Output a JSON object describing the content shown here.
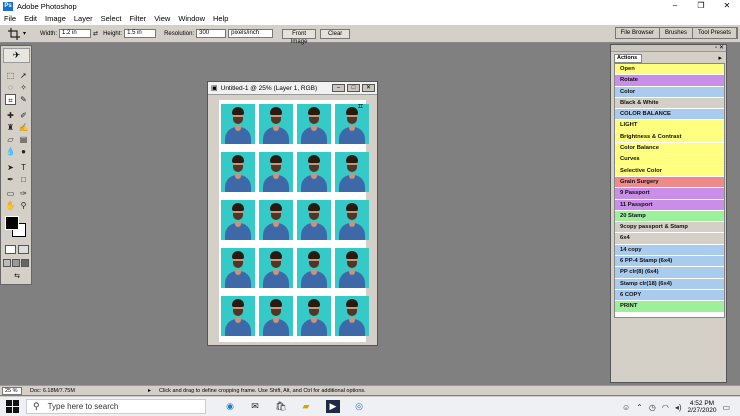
{
  "app": {
    "title": "Adobe Photoshop",
    "window_controls": [
      "–",
      "❐",
      "✕"
    ]
  },
  "menu": [
    "File",
    "Edit",
    "Image",
    "Layer",
    "Select",
    "Filter",
    "View",
    "Window",
    "Help"
  ],
  "options": {
    "width_label": "Width:",
    "width_value": "1.2 in",
    "height_label": "Height:",
    "height_value": "1.5 in",
    "resolution_label": "Resolution:",
    "resolution_value": "300",
    "resolution_unit": "pixels/inch",
    "front_image": "Front Image",
    "clear": "Clear"
  },
  "palette_well": [
    "File Browser",
    "Brushes",
    "Tool Presets"
  ],
  "document": {
    "title": "Untitled-1 @ 25% (Layer 1, RGB)",
    "rows": 5,
    "cols": 4,
    "bg_color": "#35c9c7"
  },
  "actions": {
    "tab": "Actions",
    "items": [
      {
        "label": "Open",
        "color": "#ffff7f"
      },
      {
        "label": "Rotate",
        "color": "#c88ee8"
      },
      {
        "label": "Color",
        "color": "#a9cbee"
      },
      {
        "label": "Black & White",
        "color": "#d4d0c8"
      },
      {
        "label": "COLOR BALANCE",
        "color": "#a9cbee"
      },
      {
        "label": "LIGHT",
        "color": "#ffff7f"
      },
      {
        "label": "Brightness & Contrast",
        "color": "#ffff7f"
      },
      {
        "label": "Color Balance",
        "color": "#ffff7f"
      },
      {
        "label": "Curves",
        "color": "#ffff7f"
      },
      {
        "label": "Selective Color",
        "color": "#ffff7f"
      },
      {
        "label": "Grain Surgery",
        "color": "#f08a8a"
      },
      {
        "label": "9 Passport",
        "color": "#c88ee8"
      },
      {
        "label": "11 Passport",
        "color": "#c88ee8"
      },
      {
        "label": "20 Stamp",
        "color": "#9cf09c"
      },
      {
        "label": "9copy passport & Stamp",
        "color": "#d4d0c8"
      },
      {
        "label": "6x4",
        "color": "#d4d0c8"
      },
      {
        "label": "14 copy",
        "color": "#a9cbee"
      },
      {
        "label": "6 PP-4 Stamp (6x4)",
        "color": "#a9cbee"
      },
      {
        "label": "PP clr(8) (6x4)",
        "color": "#a9cbee"
      },
      {
        "label": "Stamp clr(18) (6x4)",
        "color": "#a9cbee"
      },
      {
        "label": "6 COPY",
        "color": "#a9cbee"
      },
      {
        "label": "PRINT",
        "color": "#9cf09c"
      }
    ]
  },
  "status": {
    "zoom": "25 %",
    "doc": "Doc: 6.18M/7.75M",
    "hint": "Click and drag to define cropping frame. Use Shift, Alt, and Ctrl for additional options."
  },
  "taskbar": {
    "search_placeholder": "Type here to search",
    "time": "4:52 PM",
    "date": "2/27/2020"
  }
}
